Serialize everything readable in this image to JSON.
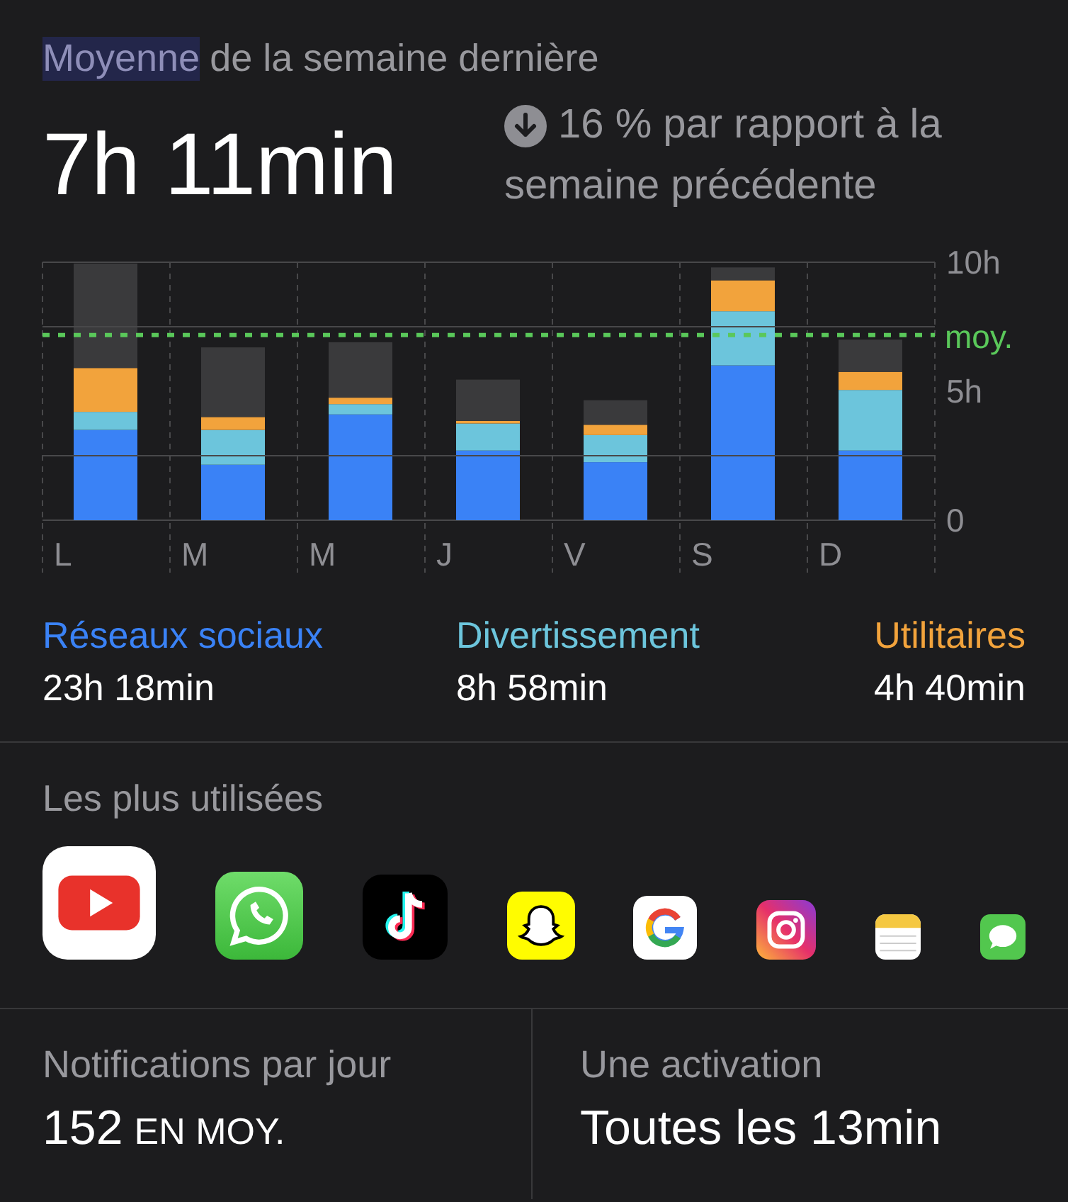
{
  "heading": {
    "parts": [
      {
        "text": "Moyenne",
        "selected": true
      },
      {
        "text": "de la semaine dernière",
        "selected": false
      }
    ]
  },
  "average": "7h 11min",
  "comparison": {
    "lines": [
      "16 % par rapport à la",
      "semaine précédente"
    ]
  },
  "chart_data": {
    "type": "bar",
    "stacked": true,
    "categories": [
      "L",
      "M",
      "M",
      "J",
      "V",
      "S",
      "D"
    ],
    "series": [
      {
        "name": "Réseaux sociaux",
        "color": "#3a82f6",
        "values": [
          3.5,
          2.15,
          4.1,
          2.7,
          2.25,
          6.0,
          2.7
        ]
      },
      {
        "name": "Divertissement",
        "color": "#6cc5dc",
        "values": [
          0.7,
          1.35,
          0.4,
          1.05,
          1.05,
          2.1,
          2.35
        ]
      },
      {
        "name": "Utilitaires",
        "color": "#f2a33c",
        "values": [
          1.7,
          0.5,
          0.25,
          0.1,
          0.4,
          1.2,
          0.7
        ]
      },
      {
        "color": "#3a3a3c",
        "values": [
          4.05,
          2.7,
          2.15,
          1.6,
          0.95,
          0.5,
          1.25
        ]
      }
    ],
    "ylim": [
      0,
      10
    ],
    "yticks": [
      {
        "value": 0,
        "label": "0"
      },
      {
        "value": 5,
        "label": "5h"
      },
      {
        "value": 10,
        "label": "10h"
      }
    ],
    "ref_lines": [
      {
        "axis": "y",
        "value": 2.5
      },
      {
        "axis": "y",
        "value": 7.5
      },
      {
        "axis": "y",
        "value": 7.18,
        "label": "moy."
      }
    ]
  },
  "legend_totals": [
    "23h 18min",
    "8h 58min",
    "4h 40min"
  ],
  "most_used": {
    "title": "Les plus utilisées",
    "apps": [
      {
        "kind": "youtube"
      },
      {
        "kind": "whatsapp"
      },
      {
        "kind": "tiktok"
      },
      {
        "kind": "snapchat"
      },
      {
        "kind": "google"
      },
      {
        "kind": "instagram"
      },
      {
        "kind": "notes"
      },
      {
        "kind": "messages"
      }
    ]
  },
  "stats": [
    {
      "label": "Notifications par jour",
      "value": "152",
      "unit": "EN MOY."
    },
    {
      "label": "Une activation",
      "value": "Toutes les 13min"
    }
  ]
}
